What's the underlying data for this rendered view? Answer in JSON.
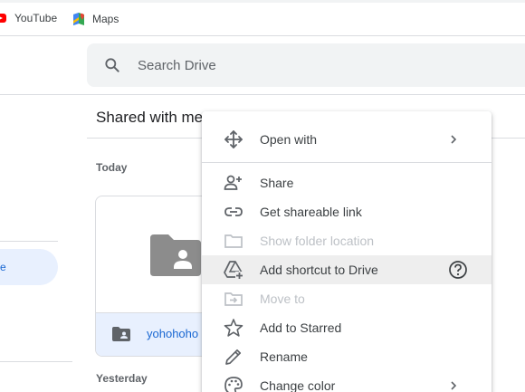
{
  "bookmarks": [
    {
      "label": "YouTube",
      "icon": "youtube-icon"
    },
    {
      "label": "Maps",
      "icon": "maps-icon"
    }
  ],
  "search": {
    "placeholder": "Search Drive"
  },
  "sidebar": {
    "active_label": "e"
  },
  "main": {
    "title": "Shared with me",
    "sections": {
      "today": "Today",
      "yesterday": "Yesterday"
    },
    "folder": {
      "name": "yohohoho"
    }
  },
  "context_menu": {
    "items": [
      {
        "label": "Open with",
        "icon": "move-arrows-icon",
        "submenu": true,
        "enabled": true
      },
      {
        "label": "Share",
        "icon": "add-person-icon",
        "enabled": true
      },
      {
        "label": "Get shareable link",
        "icon": "link-icon",
        "enabled": true
      },
      {
        "label": "Show folder location",
        "icon": "folder-outline-icon",
        "enabled": false
      },
      {
        "label": "Add shortcut to Drive",
        "icon": "drive-shortcut-icon",
        "enabled": true,
        "highlighted": true,
        "help": true
      },
      {
        "label": "Move to",
        "icon": "move-to-folder-icon",
        "enabled": false
      },
      {
        "label": "Add to Starred",
        "icon": "star-icon",
        "enabled": true
      },
      {
        "label": "Rename",
        "icon": "pencil-icon",
        "enabled": true
      },
      {
        "label": "Change color",
        "icon": "palette-icon",
        "submenu": true,
        "enabled": true
      }
    ]
  },
  "colors": {
    "accent": "#1967d2",
    "selected_bg": "#e8f0fe",
    "search_bg": "#f1f3f4",
    "menu_hover": "#eeeeee",
    "folder_gray": "#8c8c8c"
  }
}
